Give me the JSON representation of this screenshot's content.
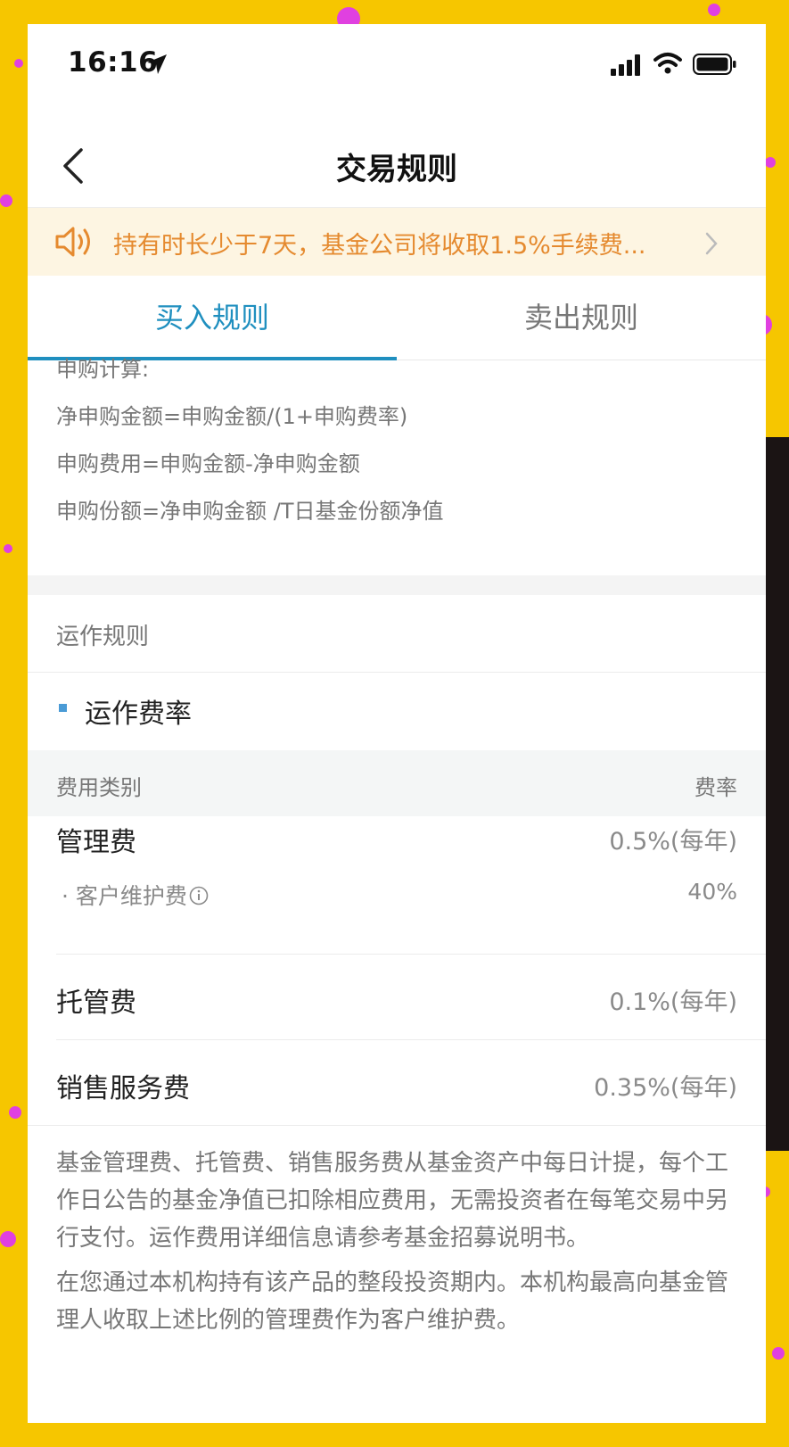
{
  "status_bar": {
    "time": "16:16"
  },
  "nav": {
    "title": "交易规则"
  },
  "notice": {
    "text": "持有时长少于7天，基金公司将收取1.5%手续费..."
  },
  "tabs": [
    {
      "label": "买入规则",
      "active": true
    },
    {
      "label": "卖出规则",
      "active": false
    }
  ],
  "calc": {
    "heading": "申购计算:",
    "lines": [
      "净申购金额=申购金额/(1+申购费率)",
      "申购费用=申购金额-净申购金额",
      "申购份额=净申购金额 /T日基金份额净值"
    ]
  },
  "operation": {
    "section_title": "运作规则",
    "sub_title": "运作费率",
    "table_header": {
      "category": "费用类别",
      "rate": "费率"
    },
    "rows": [
      {
        "label": "管理费",
        "value": "0.5%(每年)"
      },
      {
        "label": "· 客户维护费",
        "value": "40%"
      },
      {
        "label": "托管费",
        "value": "0.1%(每年)"
      },
      {
        "label": "销售服务费",
        "value": "0.35%(每年)"
      }
    ],
    "notes": [
      "基金管理费、托管费、销售服务费从基金资产中每日计提，每个工作日公告的基金净值已扣除相应费用，无需投资者在每笔交易中另行支付。运作费用详细信息请参考基金招募说明书。",
      "在您通过本机构持有该产品的整段投资期内。本机构最高向基金管理人收取上述比例的管理费作为客户维护费。"
    ]
  },
  "colors": {
    "accent": "#1f8fbf",
    "notice_text": "#e58a2f",
    "notice_bg": "#fdf5e2"
  }
}
